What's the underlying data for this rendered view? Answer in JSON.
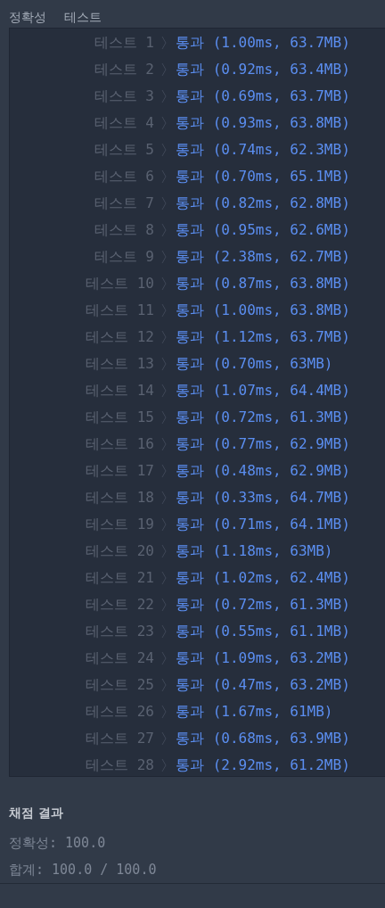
{
  "tabs": [
    {
      "label": "정확성"
    },
    {
      "label": "테스트"
    }
  ],
  "tests": [
    {
      "label": "테스트 1",
      "result": "통과 (1.00ms, 63.7MB)"
    },
    {
      "label": "테스트 2",
      "result": "통과 (0.92ms, 63.4MB)"
    },
    {
      "label": "테스트 3",
      "result": "통과 (0.69ms, 63.7MB)"
    },
    {
      "label": "테스트 4",
      "result": "통과 (0.93ms, 63.8MB)"
    },
    {
      "label": "테스트 5",
      "result": "통과 (0.74ms, 62.3MB)"
    },
    {
      "label": "테스트 6",
      "result": "통과 (0.70ms, 65.1MB)"
    },
    {
      "label": "테스트 7",
      "result": "통과 (0.82ms, 62.8MB)"
    },
    {
      "label": "테스트 8",
      "result": "통과 (0.95ms, 62.6MB)"
    },
    {
      "label": "테스트 9",
      "result": "통과 (2.38ms, 62.7MB)"
    },
    {
      "label": "테스트 10",
      "result": "통과 (0.87ms, 63.8MB)"
    },
    {
      "label": "테스트 11",
      "result": "통과 (1.00ms, 63.8MB)"
    },
    {
      "label": "테스트 12",
      "result": "통과 (1.12ms, 63.7MB)"
    },
    {
      "label": "테스트 13",
      "result": "통과 (0.70ms, 63MB)"
    },
    {
      "label": "테스트 14",
      "result": "통과 (1.07ms, 64.4MB)"
    },
    {
      "label": "테스트 15",
      "result": "통과 (0.72ms, 61.3MB)"
    },
    {
      "label": "테스트 16",
      "result": "통과 (0.77ms, 62.9MB)"
    },
    {
      "label": "테스트 17",
      "result": "통과 (0.48ms, 62.9MB)"
    },
    {
      "label": "테스트 18",
      "result": "통과 (0.33ms, 64.7MB)"
    },
    {
      "label": "테스트 19",
      "result": "통과 (0.71ms, 64.1MB)"
    },
    {
      "label": "테스트 20",
      "result": "통과 (1.18ms, 63MB)"
    },
    {
      "label": "테스트 21",
      "result": "통과 (1.02ms, 62.4MB)"
    },
    {
      "label": "테스트 22",
      "result": "통과 (0.72ms, 61.3MB)"
    },
    {
      "label": "테스트 23",
      "result": "통과 (0.55ms, 61.1MB)"
    },
    {
      "label": "테스트 24",
      "result": "통과 (1.09ms, 63.2MB)"
    },
    {
      "label": "테스트 25",
      "result": "통과 (0.47ms, 63.2MB)"
    },
    {
      "label": "테스트 26",
      "result": "통과 (1.67ms, 61MB)"
    },
    {
      "label": "테스트 27",
      "result": "통과 (0.68ms, 63.9MB)"
    },
    {
      "label": "테스트 28",
      "result": "통과 (2.92ms, 61.2MB)"
    }
  ],
  "summary": {
    "title": "채점 결과",
    "lines": [
      "정확성: 100.0",
      "합계: 100.0 / 100.0"
    ]
  }
}
